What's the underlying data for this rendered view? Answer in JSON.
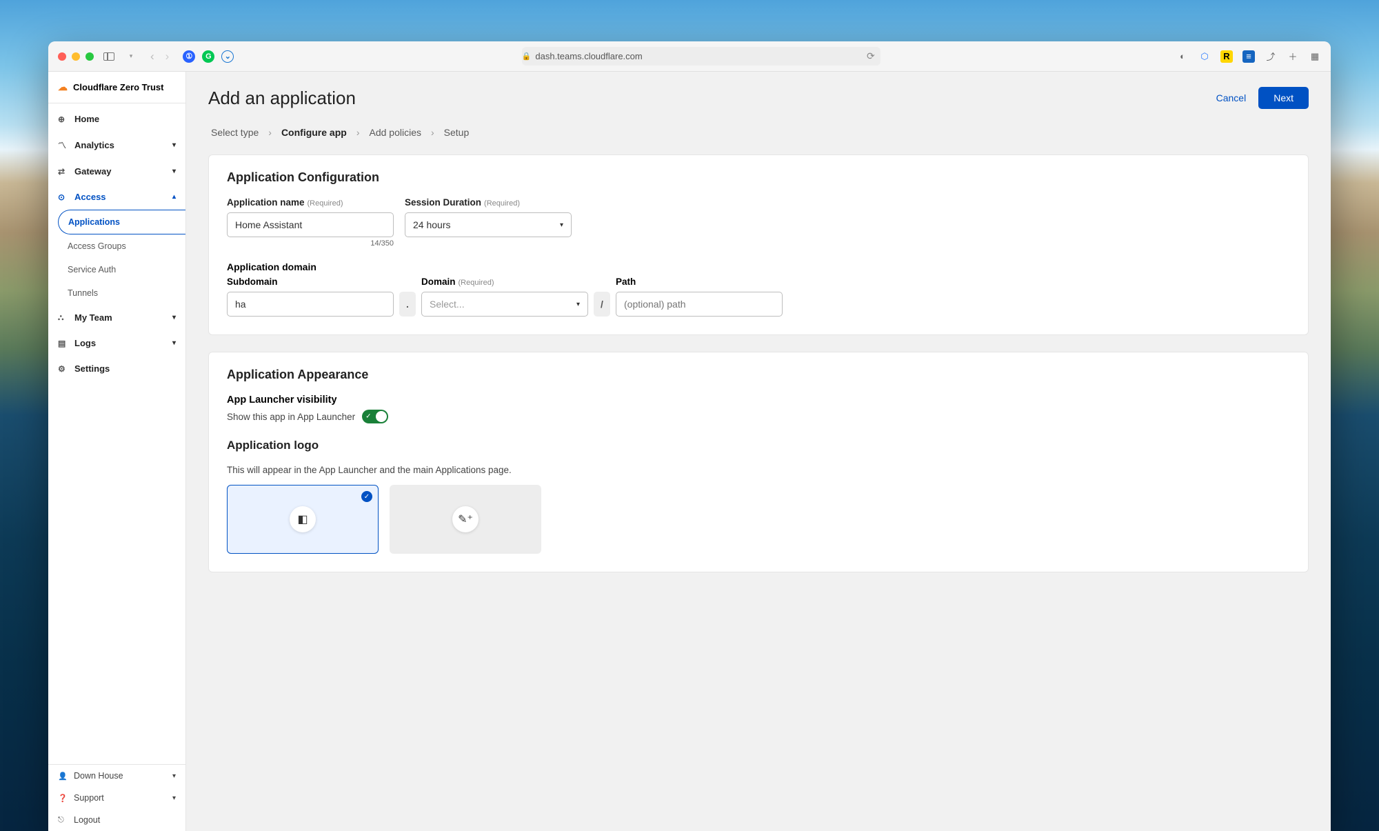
{
  "browser": {
    "url": "dash.teams.cloudflare.com"
  },
  "brand": "Cloudflare Zero Trust",
  "sidebar": {
    "items": [
      {
        "label": "Home"
      },
      {
        "label": "Analytics"
      },
      {
        "label": "Gateway"
      },
      {
        "label": "Access"
      },
      {
        "label": "My Team"
      },
      {
        "label": "Logs"
      },
      {
        "label": "Settings"
      }
    ],
    "access_sub": [
      {
        "label": "Applications"
      },
      {
        "label": "Access Groups"
      },
      {
        "label": "Service Auth"
      },
      {
        "label": "Tunnels"
      }
    ],
    "footer": [
      {
        "label": "Down House"
      },
      {
        "label": "Support"
      },
      {
        "label": "Logout"
      }
    ]
  },
  "page": {
    "title": "Add an application",
    "cancel": "Cancel",
    "next": "Next",
    "crumbs": [
      "Select type",
      "Configure app",
      "Add policies",
      "Setup"
    ],
    "crumb_current": 1
  },
  "config": {
    "heading": "Application Configuration",
    "name_label": "Application name",
    "required": "(Required)",
    "name_value": "Home Assistant",
    "name_counter": "14/350",
    "session_label": "Session Duration",
    "session_value": "24 hours",
    "domain_heading": "Application domain",
    "subdomain_label": "Subdomain",
    "subdomain_value": "ha",
    "domain_label": "Domain",
    "domain_placeholder": "Select...",
    "path_label": "Path",
    "path_placeholder": "(optional) path",
    "dot": ".",
    "slash": "/"
  },
  "appearance": {
    "heading": "Application Appearance",
    "visibility_label": "App Launcher visibility",
    "visibility_desc": "Show this app in App Launcher",
    "logo_heading": "Application logo",
    "logo_desc": "This will appear in the App Launcher and the main Applications page."
  }
}
